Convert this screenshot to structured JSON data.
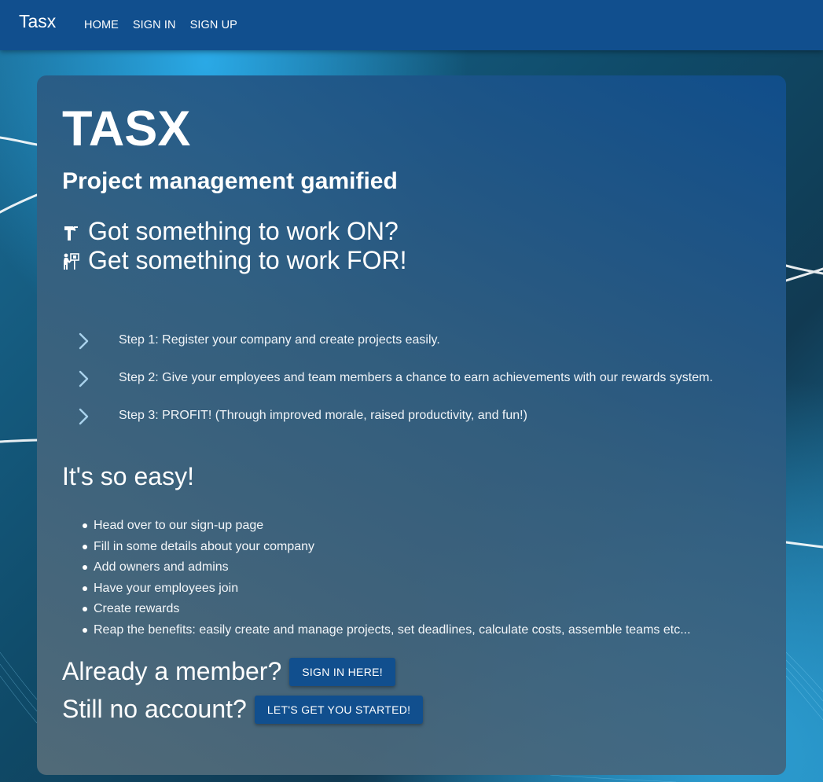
{
  "navbar": {
    "brand": "Tasx",
    "links": [
      "HOME",
      "SIGN IN",
      "SIGN UP"
    ]
  },
  "hero": {
    "title": "TASX",
    "subtitle": "Project management gamified",
    "taglines": [
      {
        "icon": "hammer-icon",
        "text": "Got something to work ON?"
      },
      {
        "icon": "trophy-goal-icon",
        "text": "Get something to work FOR!"
      }
    ]
  },
  "steps": [
    "Step 1: Register your company and create projects easily.",
    "Step 2: Give your employees and team members a chance to earn achievements with our rewards system.",
    "Step 3: PROFIT! (Through improved morale, raised productivity, and fun!)"
  ],
  "easy": {
    "heading": "It's so easy!",
    "items": [
      "Head over to our sign-up page",
      "Fill in some details about your company",
      "Add owners and admins",
      "Have your employees join",
      "Create rewards",
      "Reap the benefits: easily create and manage projects, set deadlines, calculate costs, assemble teams etc..."
    ]
  },
  "cta": {
    "member_text": "Already a member?",
    "member_button": "SIGN IN HERE!",
    "new_text": "Still no account?",
    "new_button": "LET'S GET YOU STARTED!"
  },
  "colors": {
    "navbar": "#114f8e",
    "button": "#114f8e",
    "text": "#ffffff"
  }
}
